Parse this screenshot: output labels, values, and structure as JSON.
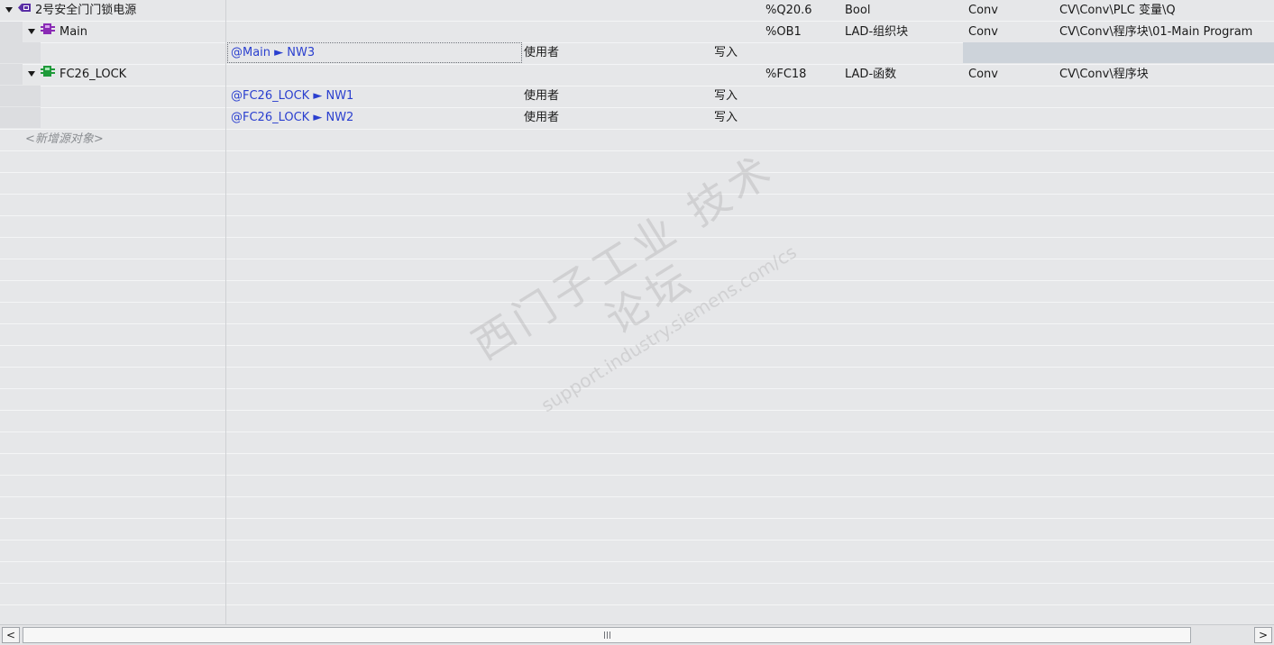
{
  "rows": [
    {
      "tree": {
        "label": "2号安全门门锁电源",
        "icon": "plc-tag-output-icon"
      },
      "address": "%Q20.6",
      "type": "Bool",
      "device": "Conv",
      "path": "CV\\Conv\\PLC 变量\\Q"
    },
    {
      "tree": {
        "label": "Main",
        "icon": "organization-block-icon"
      },
      "address": "%OB1",
      "type": "LAD-组织块",
      "device": "Conv",
      "path": "CV\\Conv\\程序块\\01-Main Program"
    },
    {
      "ref": "@Main ► NW3",
      "usage": "使用者",
      "access": "写入"
    },
    {
      "tree": {
        "label": "FC26_LOCK",
        "icon": "function-block-icon"
      },
      "address": "%FC18",
      "type": "LAD-函数",
      "device": "Conv",
      "path": "CV\\Conv\\程序块"
    },
    {
      "ref": "@FC26_LOCK ► NW1",
      "usage": "使用者",
      "access": "写入"
    },
    {
      "ref": "@FC26_LOCK ► NW2",
      "usage": "使用者",
      "access": "写入"
    }
  ],
  "new_object": "<新增源对象>",
  "scrollbar": {
    "left": "<",
    "right": ">"
  },
  "watermark": {
    "main": "西门子工业 技术论坛",
    "sub": "support.industry.siemens.com/cs"
  },
  "colors": {
    "link": "#2a3fcf",
    "tag_icon": "#5a2ea6",
    "ob_icon": "#8a2bb5",
    "fc_icon": "#1f9a3a"
  }
}
